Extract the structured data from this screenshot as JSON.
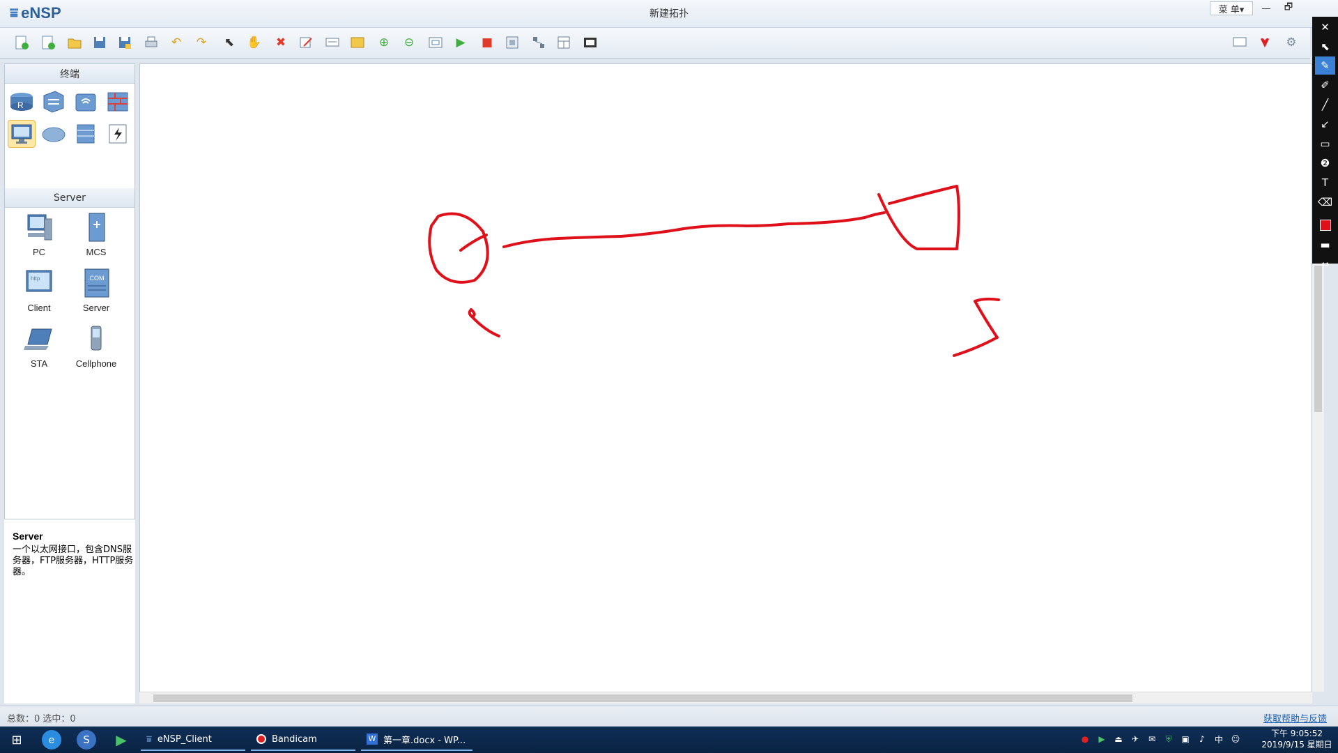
{
  "window": {
    "app_name": "eNSP",
    "title": "新建拓扑",
    "menu_label": "菜 单▾",
    "minimize_label": "—",
    "maximize_label": "🗗",
    "close_label": "✕"
  },
  "left_panel": {
    "category_header": "终端",
    "device_header": "Server",
    "devices": [
      {
        "label": "PC"
      },
      {
        "label": "MCS"
      },
      {
        "label": "Client"
      },
      {
        "label": "Server"
      },
      {
        "label": "STA"
      },
      {
        "label": "Cellphone"
      }
    ],
    "description": {
      "title": "Server",
      "text": "一个以太网接口，包含DNS服务器，FTP服务器，HTTP服务器。"
    }
  },
  "status": {
    "summary": "总数：0 选中：0",
    "help_link": "获取帮助与反馈"
  },
  "taskbar": {
    "items": [
      {
        "label": "eNSP_Client"
      },
      {
        "label": "Bandicam"
      },
      {
        "label": "第一章.docx - WP..."
      }
    ],
    "clock_time": "下午 9:05:52",
    "clock_date": "2019/9/15 星期日",
    "ime_label": "中"
  },
  "annotation": {
    "ink_color": "#e0101a"
  }
}
